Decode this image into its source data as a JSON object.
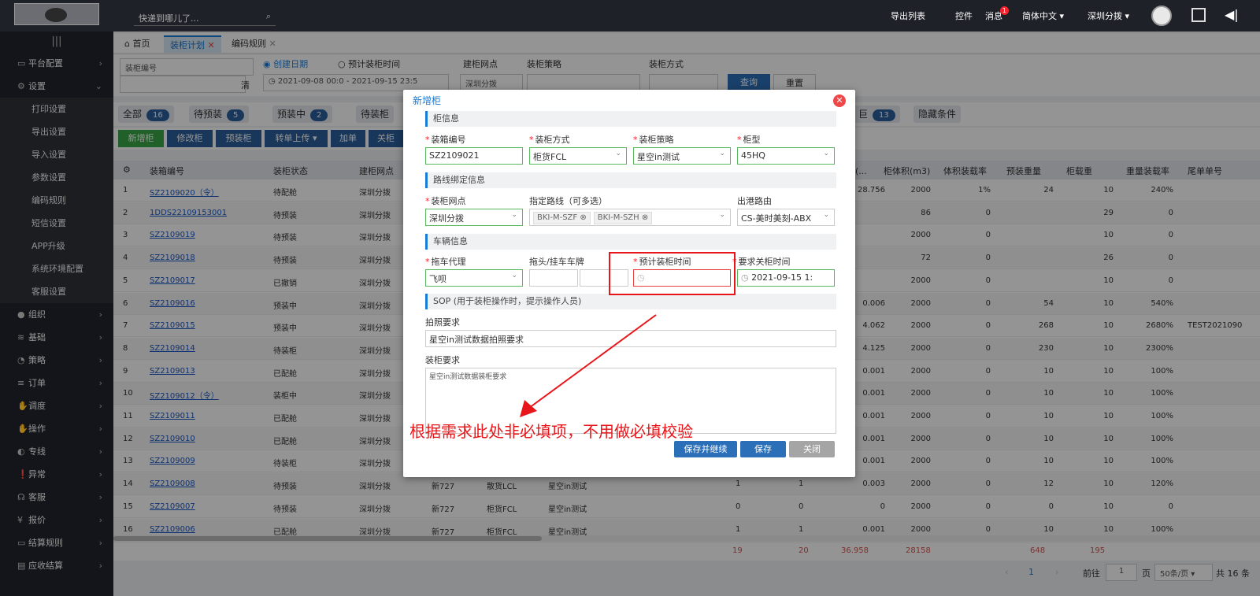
{
  "topbar": {
    "search_placeholder": "快递到哪儿了...",
    "menus": [
      "导出列表",
      "控件",
      "消息",
      "简体中文 ▾",
      "深圳分拨 ▾"
    ],
    "message_badge": "1"
  },
  "sidebar": {
    "toggle": "|||",
    "items": [
      {
        "label": "平台配置"
      },
      {
        "label": "设置"
      }
    ],
    "sub_items": [
      "打印设置",
      "导出设置",
      "导入设置",
      "参数设置",
      "编码规则",
      "短信设置",
      "APP升级",
      "系统环境配置",
      "客服设置"
    ],
    "more_items": [
      "组织",
      "基础",
      "策略",
      "订单",
      "调度",
      "操作",
      "专线",
      "异常",
      "客服",
      "报价",
      "结算规则",
      "应收结算"
    ]
  },
  "tabs": [
    "首页",
    "装柜计划",
    "编码规则"
  ],
  "filter": {
    "field_label": "装柜编号",
    "clear": "清",
    "radio1": "创建日期",
    "radio2": "预计装柜时间",
    "date_range": "2021-09-08 00:0 - 2021-09-15 23:5",
    "lbl_site": "建柜网点",
    "site_value": "深圳分拨",
    "lbl_strategy": "装柜策略",
    "lbl_method": "装柜方式",
    "query": "查询",
    "reset": "重置"
  },
  "status_chips": [
    {
      "label": "全部",
      "count": "16"
    },
    {
      "label": "待预装",
      "count": "5"
    },
    {
      "label": "预装中",
      "count": "2"
    },
    {
      "label": "待装柜",
      "count": ""
    }
  ],
  "right_chip": {
    "label": "巨",
    "count": "13"
  },
  "hide_cond": "隐藏条件",
  "toolbar": [
    "新增柜",
    "修改柜",
    "预装柜",
    "转单上传 ▾",
    "加单",
    "关柜"
  ],
  "table": {
    "headers": [
      "",
      "装箱编号",
      "装柜状态",
      "建柜网点",
      "体积(...",
      "柜体积(m3)",
      "体积装载率",
      "预装重量",
      "柜载重",
      "重量装载率",
      "尾单单号"
    ],
    "rows": [
      [
        "1",
        "SZ2109020（令）",
        "待配舱",
        "深圳分拨",
        "28.756",
        "2000",
        "1%",
        "24",
        "10",
        "240%",
        ""
      ],
      [
        "2",
        "1DDS22109153001",
        "待预装",
        "深圳分拨",
        "",
        "86",
        "0",
        "",
        "29",
        "0",
        ""
      ],
      [
        "3",
        "SZ2109019",
        "待预装",
        "深圳分拨",
        "",
        "2000",
        "0",
        "",
        "10",
        "0",
        ""
      ],
      [
        "4",
        "SZ2109018",
        "待预装",
        "深圳分拨",
        "",
        "72",
        "0",
        "",
        "26",
        "0",
        ""
      ],
      [
        "5",
        "SZ2109017",
        "已撤销",
        "深圳分拨",
        "",
        "2000",
        "0",
        "",
        "10",
        "0",
        ""
      ],
      [
        "6",
        "SZ2109016",
        "预装中",
        "深圳分拨",
        "0.006",
        "2000",
        "0",
        "54",
        "10",
        "540%",
        ""
      ],
      [
        "7",
        "SZ2109015",
        "预装中",
        "深圳分拨",
        "4.062",
        "2000",
        "0",
        "268",
        "10",
        "2680%",
        "TEST2021090"
      ],
      [
        "8",
        "SZ2109014",
        "待装柜",
        "深圳分拨",
        "4.125",
        "2000",
        "0",
        "230",
        "10",
        "2300%",
        ""
      ],
      [
        "9",
        "SZ2109013",
        "已配舱",
        "深圳分拨",
        "0.001",
        "2000",
        "0",
        "10",
        "10",
        "100%",
        ""
      ],
      [
        "10",
        "SZ2109012（令）",
        "装柜中",
        "深圳分拨",
        "0.001",
        "2000",
        "0",
        "10",
        "10",
        "100%",
        ""
      ],
      [
        "11",
        "SZ2109011",
        "已配舱",
        "深圳分拨",
        "0.001",
        "2000",
        "0",
        "10",
        "10",
        "100%",
        ""
      ],
      [
        "12",
        "SZ2109010",
        "已配舱",
        "深圳分拨",
        "0.001",
        "2000",
        "0",
        "10",
        "10",
        "100%",
        ""
      ],
      [
        "13",
        "SZ2109009",
        "待装柜",
        "深圳分拨",
        "0.001",
        "2000",
        "0",
        "10",
        "10",
        "100%",
        ""
      ],
      [
        "14",
        "SZ2109008",
        "待预装",
        "深圳分拨",
        "0.003",
        "2000",
        "0",
        "12",
        "10",
        "120%",
        ""
      ],
      [
        "15",
        "SZ2109007",
        "待预装",
        "深圳分拨",
        "0",
        "2000",
        "0",
        "0",
        "10",
        "0",
        ""
      ],
      [
        "16",
        "SZ2109006",
        "已配舱",
        "深圳分拨",
        "0.001",
        "2000",
        "0",
        "10",
        "10",
        "100%",
        ""
      ]
    ],
    "extra_cols": [
      [
        "新727",
        "散货LCL",
        "星空in测试",
        "1",
        "1"
      ],
      [
        "新727",
        "柜货FCL",
        "星空in测试",
        "0",
        "0"
      ],
      [
        "新727",
        "柜货FCL",
        "星空in测试",
        "1",
        "1"
      ]
    ],
    "totals": [
      "19",
      "20",
      "36.958",
      "28158",
      "648",
      "195"
    ]
  },
  "pager": {
    "current": "1",
    "goto_label": "前往",
    "goto_value": "1",
    "page_unit": "页",
    "size": "50条/页 ▾",
    "total": "共 16 条"
  },
  "modal": {
    "title": "新增柜",
    "sec1": "柜信息",
    "f_no": {
      "label": "装箱编号",
      "value": "SZ2109021"
    },
    "f_method": {
      "label": "装柜方式",
      "value": "柜货FCL"
    },
    "f_strategy": {
      "label": "装柜策略",
      "value": "星空in测试"
    },
    "f_type": {
      "label": "柜型",
      "value": "45HQ"
    },
    "sec2": "路线绑定信息",
    "f_site": {
      "label": "装柜网点",
      "value": "深圳分拨"
    },
    "f_route": {
      "label": "指定路线（可多选）",
      "tags": [
        "BKI-M-SZF",
        "BKI-M-SZH"
      ]
    },
    "f_port": {
      "label": "出港路由",
      "value": "CS-美时美刻-ABX"
    },
    "sec3": "车辆信息",
    "f_agent": {
      "label": "拖车代理",
      "value": "飞呗"
    },
    "f_plate": {
      "label": "拖头/挂车车牌"
    },
    "f_eta": {
      "label": "预计装柜时间",
      "value": ""
    },
    "f_close": {
      "label": "要求关柜时间",
      "value": "2021-09-15 1:"
    },
    "sec4": "SOP (用于装柜操作时，提示操作人员)",
    "f_photo": {
      "label": "拍照要求",
      "value": "星空in测试数据拍照要求"
    },
    "f_load": {
      "label": "装柜要求",
      "value": "星空in测试数据装柜要求"
    },
    "btn_save_continue": "保存并继续",
    "btn_save": "保存",
    "btn_close": "关闭"
  },
  "annotation": "根据需求此处非必填项，不用做必填校验",
  "colors": {
    "accent": "#1a7bd6",
    "annotation": "#e8161a",
    "sidebar": "#1f2128"
  }
}
